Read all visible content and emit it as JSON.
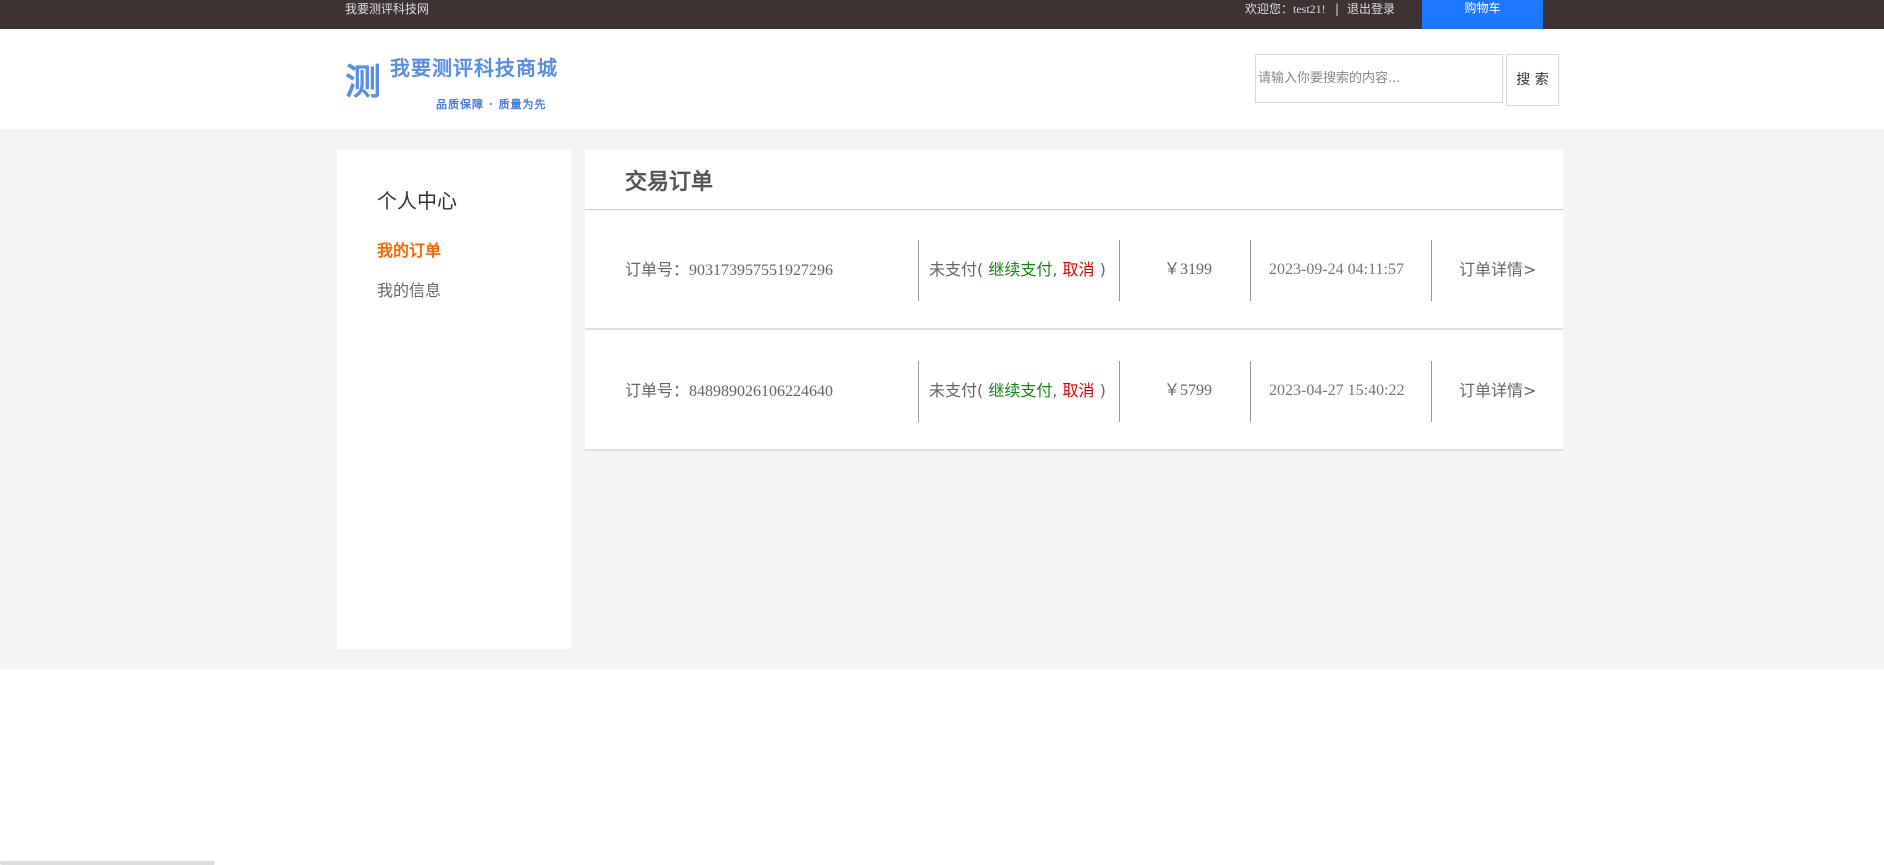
{
  "topbar": {
    "site_name": "我要测评科技网",
    "welcome_prefix": "欢迎您：",
    "username": "test21!",
    "separator": "|",
    "logout": "退出登录",
    "cart": "购物车"
  },
  "logo": {
    "mark": "测",
    "name": "我要测评科技商城",
    "slogan": "品质保障 · 质量为先"
  },
  "search": {
    "placeholder": "请输入你要搜索的内容...",
    "button": "搜 索"
  },
  "sidebar": {
    "title": "个人中心",
    "items": [
      {
        "label": "我的订单",
        "active": true
      },
      {
        "label": "我的信息",
        "active": false
      }
    ]
  },
  "main": {
    "title": "交易订单",
    "orders": [
      {
        "number_label": "订单号：",
        "number": "903173957551927296",
        "status": "未支付",
        "open_paren": "( ",
        "pay": "继续支付",
        "comma": ", ",
        "cancel": "取消",
        "close_paren": " )",
        "price": "￥3199",
        "date": "2023-09-24 04:11:57",
        "detail": "订单详情>"
      },
      {
        "number_label": "订单号：",
        "number": "848989026106224640",
        "status": "未支付",
        "open_paren": "( ",
        "pay": "继续支付",
        "comma": ", ",
        "cancel": "取消",
        "close_paren": " )",
        "price": "￥5799",
        "date": "2023-04-27 15:40:22",
        "detail": "订单详情>"
      }
    ]
  },
  "colors": {
    "topbar_bg": "#3d3333",
    "cart_bg": "#1e78ff",
    "active_nav": "#ff6600",
    "pay_link": "#138513",
    "cancel_link": "#e00000",
    "logo_blue": "#5b8ee6"
  }
}
